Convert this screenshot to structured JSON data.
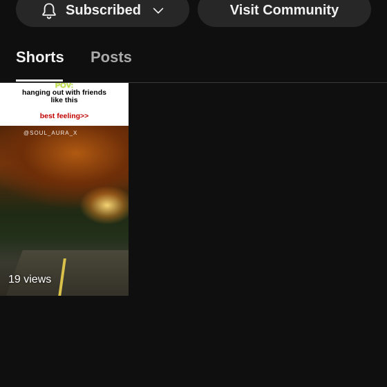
{
  "header": {
    "subscribe_label": "Subscribed",
    "community_label": "Visit Community"
  },
  "tabs": [
    {
      "label": "Shorts",
      "active": true
    },
    {
      "label": "Posts",
      "active": false
    }
  ],
  "shorts": [
    {
      "overlay_pov": "POV:",
      "overlay_caption_line1": "hanging out with friends",
      "overlay_caption_line2": "like this",
      "overlay_highlight": "best feeling>>",
      "watermark": "@SOUL_AURA_X",
      "views": "19 views"
    }
  ],
  "colors": {
    "background": "#0f0f0f",
    "button_bg": "#272727",
    "inactive_tab": "#aaaaaa",
    "highlight_red": "#c00000"
  }
}
